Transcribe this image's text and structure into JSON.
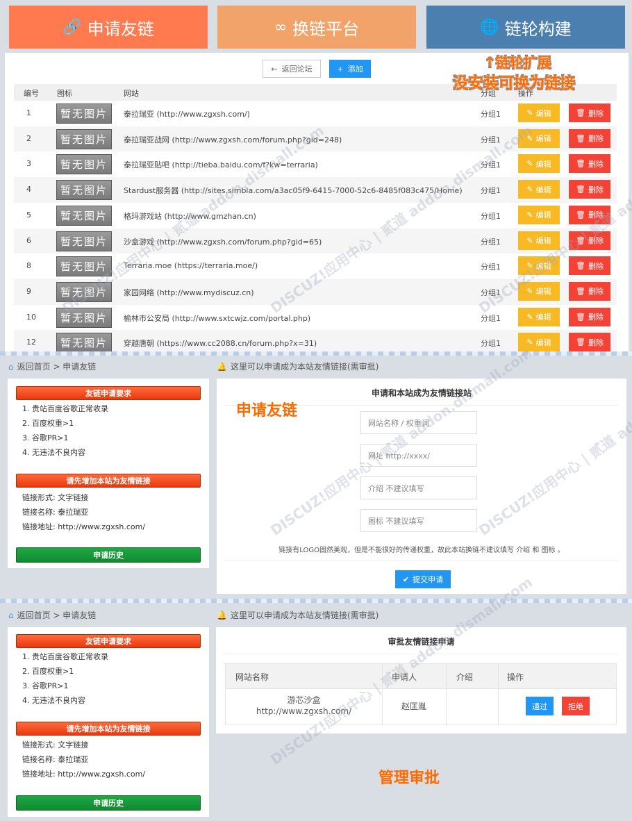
{
  "tabs": [
    {
      "label": "申请友链",
      "icon": "link-icon",
      "color": "#ff7b4f"
    },
    {
      "label": "换链平台",
      "icon": "infinity-icon",
      "color": "#f2a36a"
    },
    {
      "label": "链轮构建",
      "icon": "globe-icon",
      "color": "#4a7fb0"
    }
  ],
  "panel1": {
    "back_label": "返回论坛",
    "add_label": "添加",
    "headers": {
      "num": "编号",
      "icon": "图标",
      "site": "网站",
      "group": "分组",
      "action": "操作"
    },
    "no_image": "暂无图片",
    "edit_label": "编辑",
    "delete_label": "删除",
    "rows": [
      {
        "num": "1",
        "site": "泰拉瑞亚 (http://www.zgxsh.com/)",
        "group": "分组1"
      },
      {
        "num": "2",
        "site": "泰拉瑞亚战网 (http://www.zgxsh.com/forum.php?gid=248)",
        "group": "分组1"
      },
      {
        "num": "3",
        "site": "泰拉瑞亚贴吧 (http://tieba.baidu.com/f?kw=terraria)",
        "group": "分组1"
      },
      {
        "num": "4",
        "site": "Stardust服务器 (http://sites.simbla.com/a3ac05f9-6415-7000-52c6-8485f083c475/Home)",
        "group": "分组1"
      },
      {
        "num": "5",
        "site": "格玛游戏站 (http://www.gmzhan.cn)",
        "group": "分组1"
      },
      {
        "num": "6",
        "site": "沙盒游戏 (http://www.zgxsh.com/forum.php?gid=65)",
        "group": "分组1"
      },
      {
        "num": "8",
        "site": "Terraria.moe (https://terraria.moe/)",
        "group": "分组1"
      },
      {
        "num": "9",
        "site": "家园网络 (http://www.mydiscuz.cn)",
        "group": "分组1"
      },
      {
        "num": "10",
        "site": "榆林市公安局 (http://www.sxtcwjz.com/portal.php)",
        "group": "分组1"
      },
      {
        "num": "12",
        "site": "穿越唐朝 (https://www.cc2088.cn/forum.php?x=31)",
        "group": "分组1"
      }
    ],
    "overlay_line1": "↑链轮扩展",
    "overlay_line2": "没安装可换为链接"
  },
  "section2": {
    "breadcrumb": "返回首页 > 申请友链",
    "notice": "这里可以申请成为本站友情链接(需审批)",
    "req_title": "友链申请要求",
    "requirements": [
      "1. 贵站百度谷歌正常收录",
      "2. 百度权重>1",
      "3. 谷歌PR>1",
      "4. 无违法不良内容"
    ],
    "add_title": "请先增加本站为友情链接",
    "link_form": "链接形式: 文字链接",
    "link_name": "链接名称: 泰拉瑞亚",
    "link_url": "链接地址: http://www.zgxsh.com/",
    "history": "申请历史",
    "big_label": "申请友链",
    "form_title": "申请和本站成为友情链接站",
    "placeholders": [
      "网站名称 / 权重词",
      "网址 http://xxxx/",
      "介绍 不建议填写",
      "图标 不建议填写"
    ],
    "note": "链接有LOGO固然美观，但是不能很好的传递权重，故此本站换链不建议填写 介绍 和 图标 。",
    "submit": "提交申请"
  },
  "section3": {
    "breadcrumb": "返回首页 > 申请友链",
    "notice": "这里可以申请成为本站友情链接(需审批)",
    "req_title": "友链申请要求",
    "requirements": [
      "1. 贵站百度谷歌正常收录",
      "2. 百度权重>1",
      "3. 谷歌PR>1",
      "4. 无违法不良内容"
    ],
    "add_title": "请先增加本站为友情链接",
    "link_form": "链接形式: 文字链接",
    "link_name": "链接名称: 泰拉瑞亚",
    "link_url": "链接地址: http://www.zgxsh.com/",
    "history": "申请历史",
    "table_title": "审批友情链接申请",
    "headers": {
      "site": "网站名称",
      "applicant": "申请人",
      "intro": "介绍",
      "action": "操作"
    },
    "row": {
      "site_name": "游芯沙盒",
      "site_url": "http://www.zgxsh.com/",
      "applicant": "赵匡胤"
    },
    "pass": "通过",
    "reject": "拒绝",
    "big_label": "管理审批"
  },
  "watermark": "DISCUZ!应用中心 | 贰道 addon.dismall.com"
}
